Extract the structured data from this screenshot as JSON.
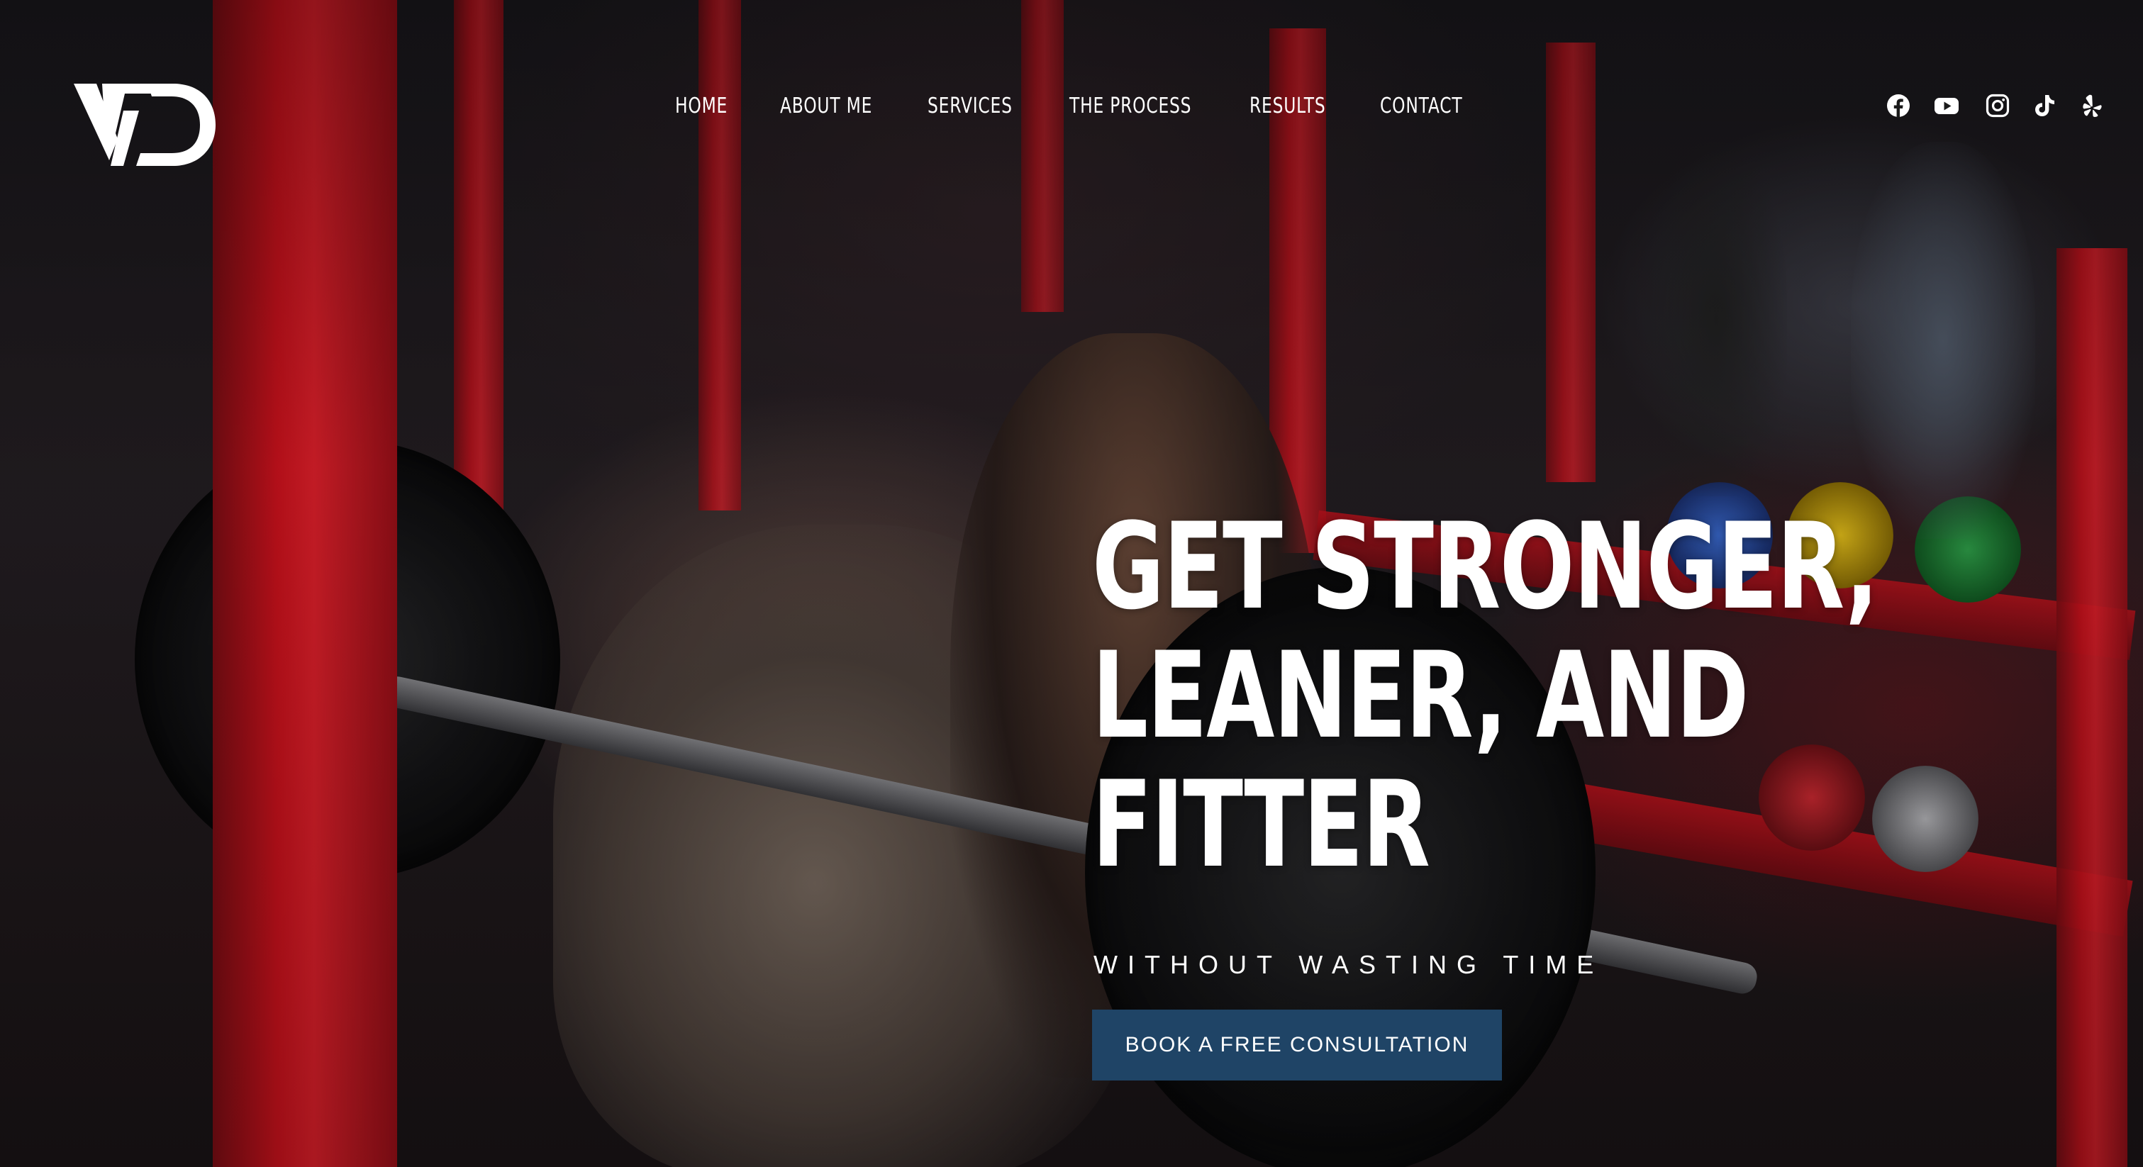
{
  "brand": {
    "logo_text": "VD",
    "colors": {
      "accent_red": "#d1121d",
      "cta_blue": "#1f4466",
      "text": "#ffffff"
    }
  },
  "nav": {
    "items": [
      {
        "label": "HOME"
      },
      {
        "label": "ABOUT ME"
      },
      {
        "label": "SERVICES"
      },
      {
        "label": "THE PROCESS"
      },
      {
        "label": "RESULTS"
      },
      {
        "label": "CONTACT"
      }
    ]
  },
  "social": {
    "icons": [
      "facebook-icon",
      "youtube-icon",
      "instagram-icon",
      "tiktok-icon",
      "yelp-icon"
    ]
  },
  "hero": {
    "headline_lines": [
      "GET STRONGER,",
      "LEANER, AND",
      "FITTER"
    ],
    "subheadline": "WITHOUT WASTING TIME",
    "cta_label": "BOOK A FREE CONSULTATION"
  }
}
